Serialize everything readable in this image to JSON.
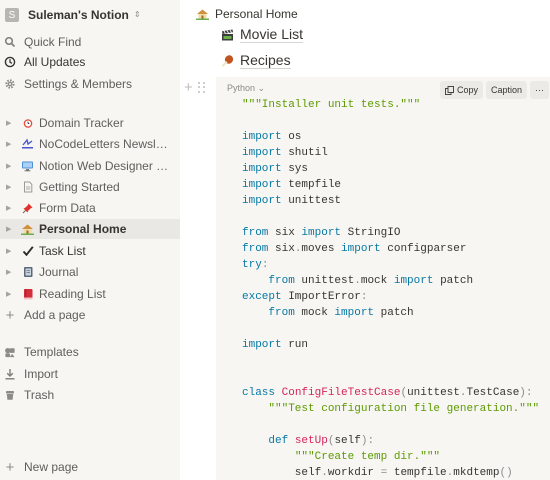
{
  "workspace": {
    "avatar": "S",
    "name": "Suleman's Notion"
  },
  "nav": [
    {
      "label": "Quick Find",
      "icon": "search-icon"
    },
    {
      "label": "All Updates",
      "icon": "clock-icon"
    },
    {
      "label": "Settings & Members",
      "icon": "gear-icon"
    }
  ],
  "pages": [
    {
      "label": "Domain Tracker",
      "icon": "alarm-clock-icon"
    },
    {
      "label": "NoCodeLetters Newslet...",
      "icon": "newsletter-icon"
    },
    {
      "label": "Notion Web Designer Hub",
      "icon": "monitor-icon"
    },
    {
      "label": "Getting Started",
      "icon": "document-icon"
    },
    {
      "label": "Form Data",
      "icon": "pushpin-icon"
    },
    {
      "label": "Personal Home",
      "icon": "house-icon"
    },
    {
      "label": "Task List",
      "icon": "check-mark-icon"
    },
    {
      "label": "Journal",
      "icon": "notebook-icon"
    },
    {
      "label": "Reading List",
      "icon": "book-icon"
    }
  ],
  "add_page": "Add a page",
  "footer_nav": [
    {
      "label": "Templates",
      "icon": "templates-icon"
    },
    {
      "label": "Import",
      "icon": "import-icon"
    },
    {
      "label": "Trash",
      "icon": "trash-icon"
    }
  ],
  "new_page": "New page",
  "breadcrumb": {
    "title": "Personal Home",
    "icon": "house-icon"
  },
  "page_links": [
    {
      "label": "Movie List",
      "icon": "clapper-board-icon"
    },
    {
      "label": "Recipes",
      "icon": "poultry-leg-icon"
    }
  ],
  "code_block": {
    "language": "Python",
    "copy_label": "Copy",
    "caption_label": "Caption",
    "more_label": "···",
    "lines": [
      "\"\"\"Installer unit tests.\"\"\"",
      "",
      "import os",
      "import shutil",
      "import sys",
      "import tempfile",
      "import unittest",
      "",
      "from six import StringIO",
      "from six.moves import configparser",
      "try:",
      "    from unittest.mock import patch",
      "except ImportError:",
      "    from mock import patch",
      "",
      "import run",
      "",
      "",
      "class ConfigFileTestCase(unittest.TestCase):",
      "    \"\"\"Test configuration file generation.\"\"\"",
      "",
      "    def setUp(self):",
      "        \"\"\"Create temp dir.\"\"\"",
      "        self.workdir = tempfile.mkdtemp()"
    ]
  }
}
